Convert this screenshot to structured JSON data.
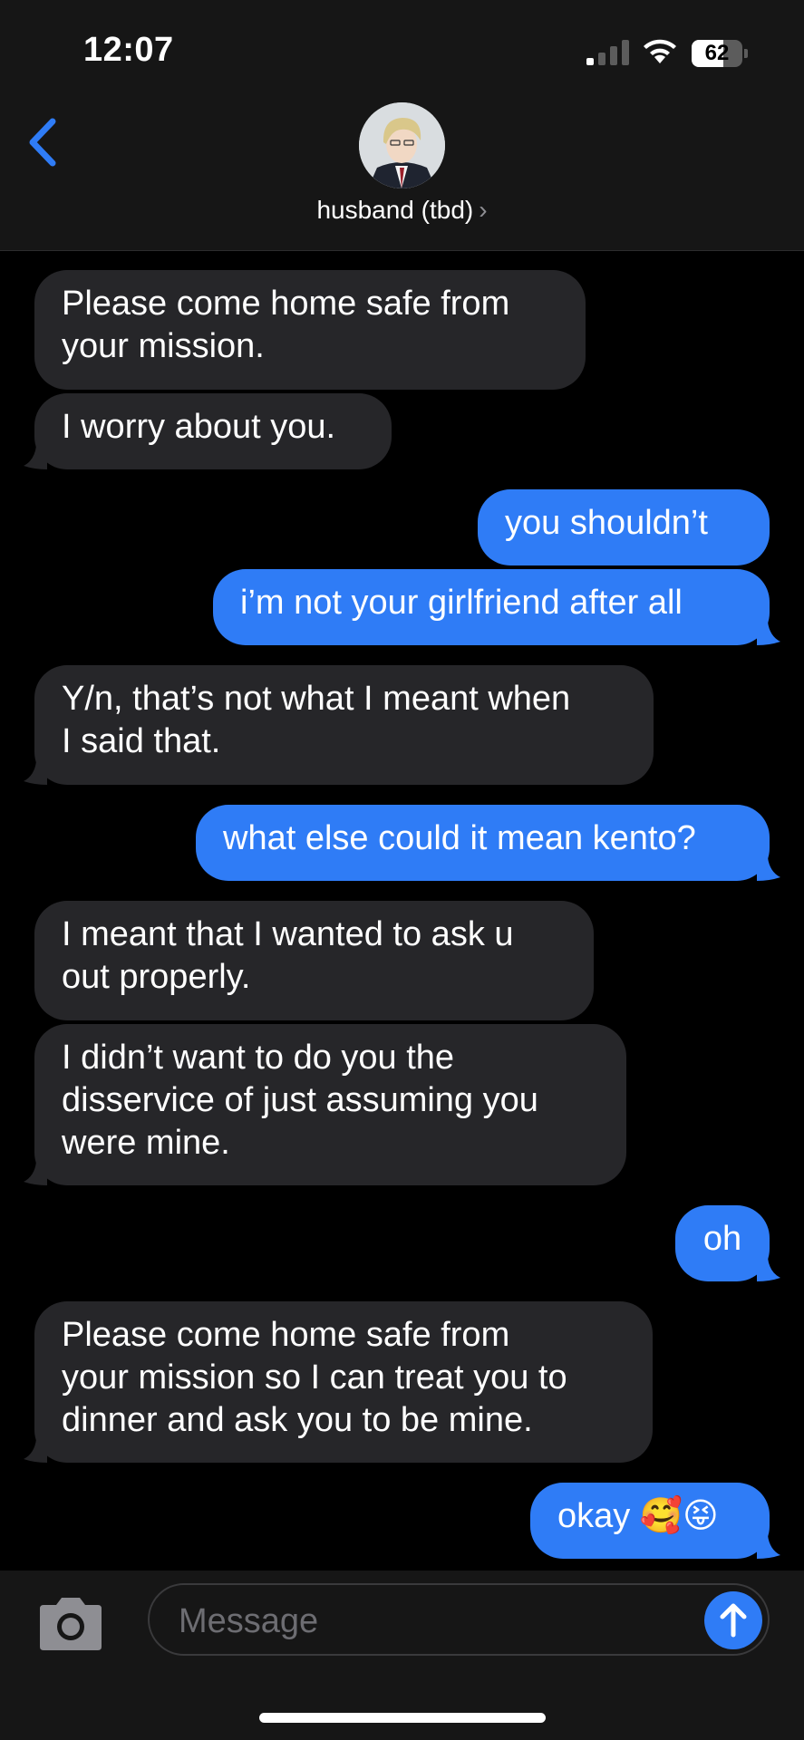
{
  "status_bar": {
    "time": "12:07",
    "battery": "62",
    "battery_level": 0.62
  },
  "header": {
    "contact_name": "husband (tbd)",
    "chevron": "›"
  },
  "messages": [
    {
      "from": "them",
      "text": "Please come home safe from\nyour mission."
    },
    {
      "from": "them",
      "text": "I worry about you."
    },
    {
      "from": "me",
      "text": "you shouldn’t"
    },
    {
      "from": "me",
      "text": "i’m not your girlfriend after all"
    },
    {
      "from": "them",
      "text": "Y/n, that’s not what I meant when\nI said that."
    },
    {
      "from": "me",
      "text": "what else could it mean kento?"
    },
    {
      "from": "them",
      "text": "I meant that I wanted to ask u\nout properly."
    },
    {
      "from": "them",
      "text": "I didn’t want to do you the\ndisservice of just assuming you\nwere mine."
    },
    {
      "from": "me",
      "text": "oh"
    },
    {
      "from": "them",
      "text": "Please come home safe from\nyour mission so I can treat you to\ndinner and ask you to be mine."
    },
    {
      "from": "me",
      "text": "okay 🥰😝"
    }
  ],
  "compose": {
    "placeholder": "Message"
  },
  "colors": {
    "incoming_bubble": "#262629",
    "outgoing_bubble": "#2f7cf6",
    "background": "#000000",
    "bars": "#161616"
  },
  "icons": {
    "back": "chevron-left-icon",
    "camera": "camera-icon",
    "send": "arrow-up-icon",
    "signal": "cellular-signal-icon",
    "wifi": "wifi-icon",
    "battery": "battery-icon"
  }
}
